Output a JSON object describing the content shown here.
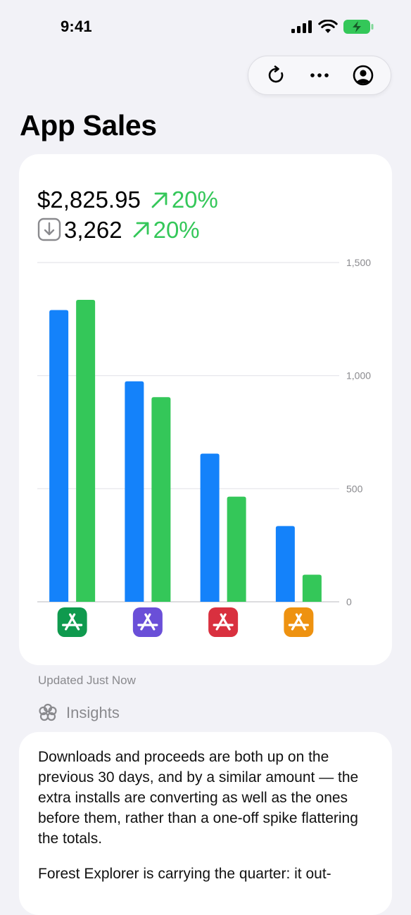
{
  "status": {
    "time": "9:41"
  },
  "toolbar": {
    "refresh": "refresh",
    "more": "more",
    "account": "account"
  },
  "page": {
    "title": "App Sales"
  },
  "summary": {
    "proceeds": "$2,825.95",
    "proceeds_change": "20%",
    "downloads": "3,262",
    "downloads_change": "20%"
  },
  "colors": {
    "series_a": "#1482FA",
    "series_b": "#34C759",
    "positive": "#34C759"
  },
  "chart_data": {
    "type": "bar",
    "categories": [
      "app-green",
      "app-purple",
      "app-red",
      "app-orange"
    ],
    "category_icon_colors": [
      "#0F9A4E",
      "#6A4FD8",
      "#D9303F",
      "#EE9210"
    ],
    "series": [
      {
        "values": [
          1290,
          975,
          655,
          335
        ],
        "color": "#1482FA"
      },
      {
        "values": [
          1335,
          905,
          465,
          120
        ],
        "color": "#34C759"
      }
    ],
    "ylim": [
      0,
      1500
    ],
    "yticks": [
      0,
      500,
      1000,
      1500
    ],
    "ytick_labels": [
      "0",
      "500",
      "1,000",
      "1,500"
    ],
    "grid": true
  },
  "updated": "Updated Just Now",
  "insights": {
    "title": "Insights",
    "paragraphs": [
      "Downloads and proceeds are both up on the previous 30 days, and by a similar amount — the extra installs are converting as well as the ones before them, rather than a one-off spike flattering the totals.",
      "Forest Explorer is carrying the quarter: it out-"
    ]
  }
}
